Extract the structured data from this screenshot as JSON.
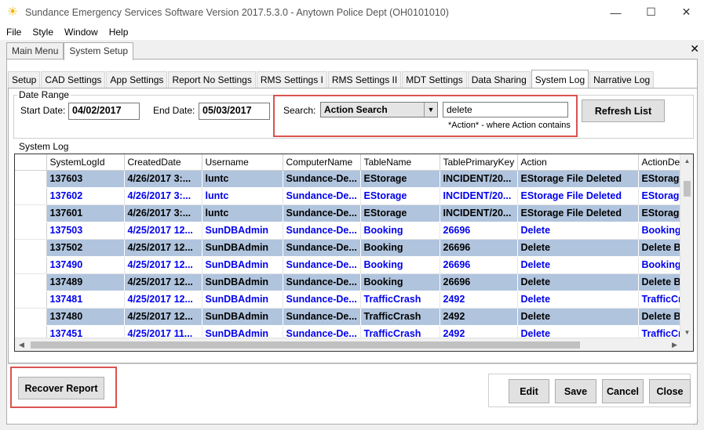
{
  "window": {
    "title": "Sundance Emergency Services Software Version 2017.5.3.0 - Anytown Police Dept (OH0101010)",
    "minimize": "—",
    "maximize": "☐",
    "close": "✕"
  },
  "menu": [
    "File",
    "Style",
    "Window",
    "Help"
  ],
  "outer_tabs": [
    "Main Menu",
    "System Setup"
  ],
  "outer_close": "✕",
  "inner_tabs": [
    "Setup",
    "CAD Settings",
    "App Settings",
    "Report No Settings",
    "RMS Settings I",
    "RMS Settings II",
    "MDT Settings",
    "Data Sharing",
    "System Log",
    "Narrative Log"
  ],
  "date_range": {
    "label": "Date Range",
    "start_label": "Start Date:",
    "start_value": "04/02/2017",
    "end_label": "End Date:",
    "end_value": "05/03/2017"
  },
  "search": {
    "label": "Search:",
    "mode": "Action Search",
    "value": "delete",
    "hint": "*Action* - where Action contains"
  },
  "refresh_label": "Refresh List",
  "system_log": {
    "label": "System Log",
    "columns": [
      "SystemLogId",
      "CreatedDate",
      "Username",
      "ComputerName",
      "TableName",
      "TablePrimaryKey",
      "Action",
      "ActionDe"
    ],
    "rows": [
      [
        "137603",
        "4/26/2017 3:...",
        "luntc",
        "Sundance-De...",
        "EStorage",
        "INCIDENT/20...",
        "EStorage File Deleted",
        "EStorage"
      ],
      [
        "137602",
        "4/26/2017 3:...",
        "luntc",
        "Sundance-De...",
        "EStorage",
        "INCIDENT/20...",
        "EStorage File Deleted",
        "EStorage"
      ],
      [
        "137601",
        "4/26/2017 3:...",
        "luntc",
        "Sundance-De...",
        "EStorage",
        "INCIDENT/20...",
        "EStorage File Deleted",
        "EStorage"
      ],
      [
        "137503",
        "4/25/2017 12...",
        "SunDBAdmin",
        "Sundance-De...",
        "Booking",
        "26696",
        "Delete",
        "Booking"
      ],
      [
        "137502",
        "4/25/2017 12...",
        "SunDBAdmin",
        "Sundance-De...",
        "Booking",
        "26696",
        "Delete",
        "Delete B"
      ],
      [
        "137490",
        "4/25/2017 12...",
        "SunDBAdmin",
        "Sundance-De...",
        "Booking",
        "26696",
        "Delete",
        "Booking"
      ],
      [
        "137489",
        "4/25/2017 12...",
        "SunDBAdmin",
        "Sundance-De...",
        "Booking",
        "26696",
        "Delete",
        "Delete B"
      ],
      [
        "137481",
        "4/25/2017 12...",
        "SunDBAdmin",
        "Sundance-De...",
        "TrafficCrash",
        "2492",
        "Delete",
        "TrafficCr"
      ],
      [
        "137480",
        "4/25/2017 12...",
        "SunDBAdmin",
        "Sundance-De...",
        "TrafficCrash",
        "2492",
        "Delete",
        "Delete B"
      ],
      [
        "137451",
        "4/25/2017 11...",
        "SunDBAdmin",
        "Sundance-De...",
        "TrafficCrash",
        "2492",
        "Delete",
        "TrafficCr"
      ]
    ],
    "shaded_rows": [
      true,
      false,
      true,
      false,
      true,
      false,
      true,
      false,
      true,
      false
    ]
  },
  "buttons": {
    "recover": "Recover Report",
    "edit": "Edit",
    "save": "Save",
    "cancel": "Cancel",
    "close": "Close"
  },
  "colors": {
    "shaded_row": "#b0c4de",
    "link_text": "#0000ee",
    "highlight": "#d9534f"
  }
}
